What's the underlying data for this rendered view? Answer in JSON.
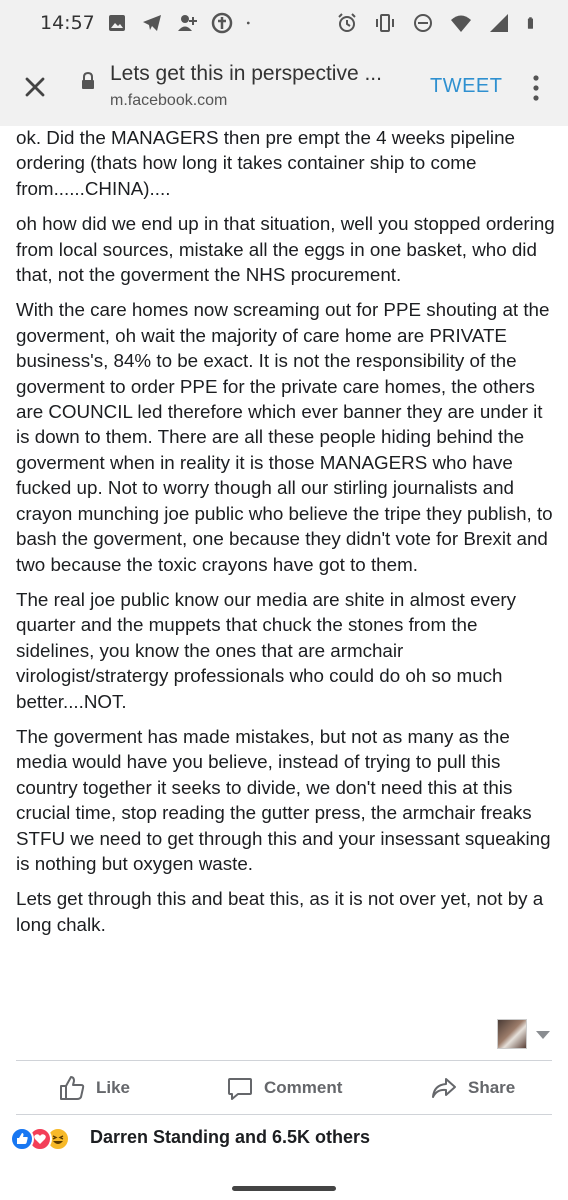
{
  "status_bar": {
    "time": "14:57",
    "left_icons": [
      "image-icon",
      "telegram-icon",
      "add-contact-icon",
      "app-icon",
      "dot-icon"
    ],
    "right_icons": [
      "alarm-icon",
      "vibrate-icon",
      "dnd-icon",
      "wifi-icon",
      "signal-icon",
      "battery-icon"
    ]
  },
  "browser": {
    "title": "Lets get this in perspective ...",
    "url": "m.facebook.com",
    "action_label": "TWEET"
  },
  "post": {
    "paragraphs": [
      "ok. Did the MANAGERS then pre empt the 4 weeks pipeline ordering (thats how long it takes container ship to come from......CHINA)....",
      "oh how did we end up in that situation, well you stopped ordering from local sources, mistake all the eggs in one basket, who did that, not the goverment the NHS procurement.",
      "With the care homes now screaming out for PPE shouting at the goverment, oh wait the majority of care home are PRIVATE business's, 84% to be exact. It is not the responsibility of the goverment to order PPE for the private care homes, the others are COUNCIL led therefore which ever banner they are under it is down to them. There are all these people hiding behind the goverment when in reality it is those MANAGERS who have fucked up. Not to worry though all our stirling journalists and crayon munching joe public who believe the tripe they publish, to bash the goverment, one because they didn't vote for Brexit and two because the toxic crayons have got to them.",
      "The real joe public know our media are shite in almost every quarter and the muppets that chuck the stones from the sidelines, you know the ones that are armchair virologist/stratergy professionals who could do oh so much better....NOT.",
      "The goverment has made mistakes, but not as many as the media would have you believe, instead of trying to pull this country together it seeks to divide, we don't need this at this crucial time, stop reading the gutter press, the armchair freaks STFU we need to get through this and your insessant squeaking is nothing but oxygen waste.",
      "Lets get through this and beat this, as it is not over yet, not by a long chalk."
    ]
  },
  "actions": {
    "like": "Like",
    "comment": "Comment",
    "share": "Share"
  },
  "reactions": {
    "types": [
      "like",
      "love",
      "haha"
    ],
    "summary": "Darren Standing and 6.5K others"
  },
  "colors": {
    "accent": "#2f90d0",
    "chrome_bg": "#f1f1f1",
    "action_text": "#65676b",
    "like_blue": "#1877f2",
    "love_red": "#f33e58",
    "haha_yellow": "#f7b928"
  }
}
